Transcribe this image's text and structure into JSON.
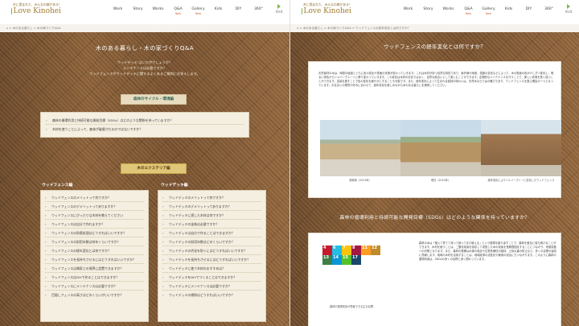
{
  "header": {
    "tagline": "木に囲まれた、みんなの森がある！",
    "brand": "Love Kinohei",
    "nav": [
      {
        "label": "Work",
        "badge": ""
      },
      {
        "label": "Story",
        "badge": ""
      },
      {
        "label": "Works",
        "badge": ""
      },
      {
        "label": "Q&A",
        "badge": "New"
      },
      {
        "label": "Gallery",
        "badge": "New"
      },
      {
        "label": "Kids",
        "badge": ""
      },
      {
        "label": "DIY",
        "badge": ""
      },
      {
        "label": "360°",
        "badge": ""
      }
    ],
    "visit_label": "Visit"
  },
  "left": {
    "breadcrumb": "⌂ > 木のある暮らし > 木の家づくりQ&A",
    "title": "木のある暮らし・木の家づくりQ&A",
    "intro": [
      "ウッドデッキ はいかがでしょうか？",
      "メンテナンスは必要ですか？",
      "ウッドフェンスやウッドデッキに関するよくあるご質問にお答えします。"
    ],
    "cycle_label": "森林のサイクル・環境編",
    "cycle_items": [
      "森林の循環利用と持続可能な開発目標（SDGs）はどのような関係を持っていますか？",
      "木材を使うことによって、森林が破壊されるのではないですか？"
    ],
    "exterior_label": "木のエクステリア編",
    "fence_head": "ウッドフェンス編",
    "deck_head": "ウッドデッキ編",
    "fence_items": [
      "ウッドフェンスのメリットって何ですか？",
      "ウッドフェンスのデメリットってありますか？",
      "ウッドフェンスにぴったりな木材を教えてください",
      "ウッドフェンスは自分で作れますか？",
      "ウッドフェンスの防腐処理はどうすればいいですか？",
      "ウッドフェンスの耐用年数は何年くらいですか？",
      "ウッドフェンスの経年変化とは何ですか？",
      "ウッドフェンスを長持ちさせるにはどうすればいいですか？",
      "ウッドフェンスは隣家との境界に設置できますか？",
      "ウッドフェンスはDIYで作ることはできますか？",
      "ウッドフェンスにメンテナンスは必要ですか？",
      "目隠しフェンスの高さはどのくらいがいいですか？"
    ],
    "deck_items": [
      "ウッドデッキのメリットって何ですか？",
      "ウッドデッキのデメリットってありますか？",
      "ウッドデッキに適した木材は何ですか？",
      "ウッドデッキの塗装は必要ですか？",
      "ウッドデッキは自分で作ることはできますか？",
      "ウッドデッキの耐用年数はどのくらいですか？",
      "ウッドデッキの劣化を防ぐにはどうすればいいですか？",
      "ウッドデッキを長持ちさせるにはどうすればいいですか？",
      "ウッドデッキに使う木材のおすすめは？",
      "ウッドデッキをDIYでつくることはできますか？",
      "ウッドデッキにメンテナンスは必要ですか？",
      "ウッドデッキの掃除はどうすればいいですか？"
    ]
  },
  "right": {
    "breadcrumb": "⌂ > 木のある暮らし > 木の家づくりQ&A > ウッドフェンスの経年変化とは何ですか？",
    "q1_title": "ウッドフェンスの経年変化とは何ですか？",
    "q1_body": "天然素材の木は、時間の経過とともに色の変化や表面の状態が変わっていきます。これは木材が持つ自然な特性であり、紫外線や雨風、湿度の変化などによって、木の表面の色が少しずつ変化し、明るい茶色からシルバーグレーへと移り変わっていきます。この変化は木材の劣化ではなく、自然な風合いとして楽しむことができます。定期的なメンテナンスを行うことで、美しい状態を長く保つことができます。塗装を施すことで色の変化を緩やかにすることも可能です。また、経年変化によって生まれる独特の味わいは、天然木ならではの魅力であり、ウッドフェンスを選ぶ理由の一つとなっています。お住まいの環境や好みに合わせて、経年変化を楽しみながら木のある暮らしを満喫してください。",
    "photos": [
      {
        "caption": "新築時（2024年）"
      },
      {
        "caption": "現在（2024年）"
      },
      {
        "caption": "経年変化によりシルバーグレーに変化したウッドフェンス"
      }
    ],
    "q2_title": "森林の循環利用と持続可能な開発目標（SDGs）はどのような関係を持っていますか？",
    "sdgs_caption": "森林の循環利用が貢献できる主な目標",
    "sdgs_body": "森林の木は「植えて育てて伐って使ってまた植える」という循環を繰り返すことで、森林を健全に保ち続けることができます。木材を使うことは、二酸化炭素を吸収して成長した木の炭素を長期間固定することにつながり、気候変動への対策となります。また、森林の整備は水源の保全や生物多様性の維持、土砂災害の防止など、多くの目標の達成に貢献します。地域の木材を活用することは、地域経済の活性化や雇用の創出にもつながります。このように森林の循環利用は、SDGsの多くの目標と深く関わっています。",
    "sdgs_tiles": [
      {
        "num": "4",
        "color": "#c5192d"
      },
      {
        "num": "6",
        "color": "#26bde2"
      },
      {
        "num": "7",
        "color": "#fcc30b"
      },
      {
        "num": "8",
        "color": "#a21942"
      },
      {
        "num": "11",
        "color": "#fd9d24"
      },
      {
        "num": "12",
        "color": "#bf8b2e"
      },
      {
        "num": "13",
        "color": "#3f7e44"
      },
      {
        "num": "14",
        "color": "#0a97d9"
      },
      {
        "num": "15",
        "color": "#56c02b"
      },
      {
        "num": "17",
        "color": "#19486a"
      }
    ]
  }
}
